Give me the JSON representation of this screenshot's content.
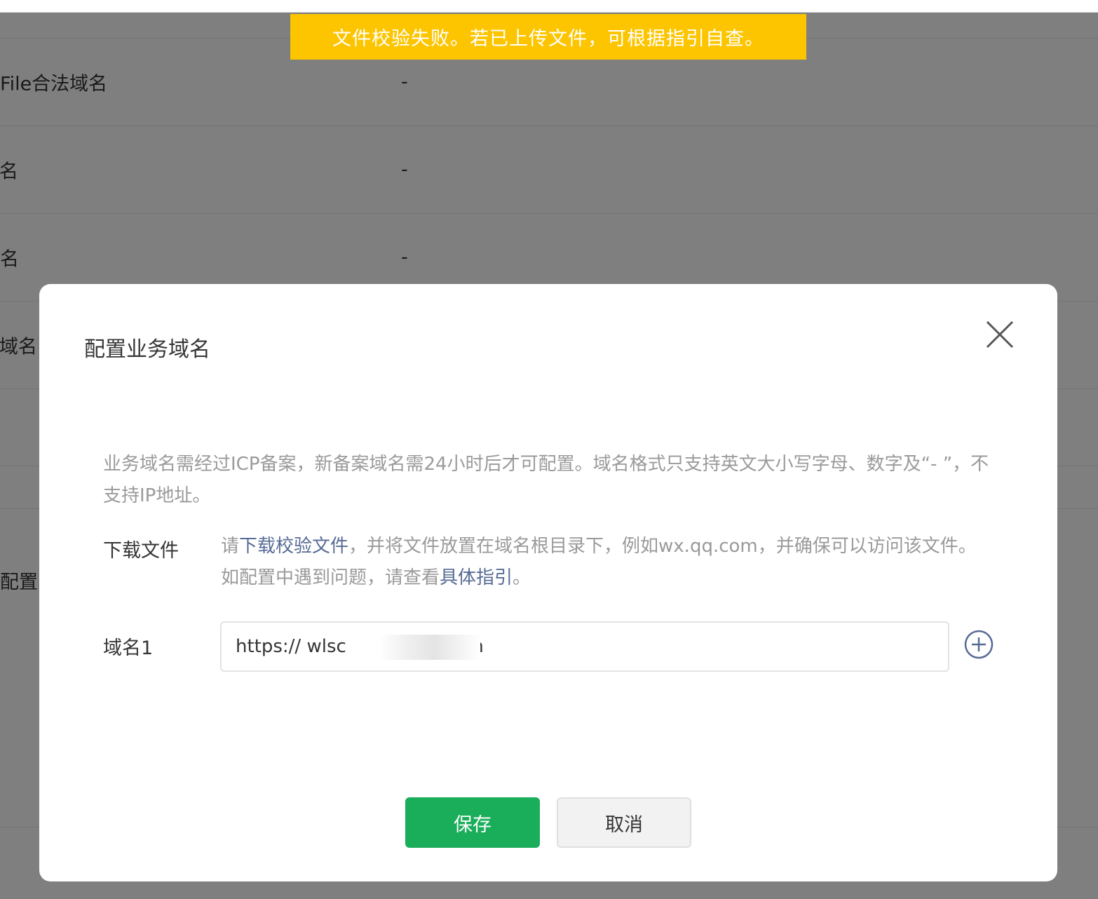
{
  "toast": {
    "message": "文件校验失败。若已上传文件，可根据指引自查。"
  },
  "background": {
    "rows": [
      {
        "label": "File合法域名",
        "value": "-"
      },
      {
        "label": "域名",
        "value": "-"
      },
      {
        "label": "名",
        "value": "-"
      },
      {
        "label": "新域名",
        "value": ""
      }
    ],
    "config_label": "配置"
  },
  "modal": {
    "title": "配置业务域名",
    "notice": "业务域名需经过ICP备案，新备案域名需24小时后才可配置。域名格式只支持英文大小写字母、数字及“- ”，不支持IP地址。",
    "download": {
      "label": "下载文件",
      "prefix": "请",
      "link": "下载校验文件",
      "middle": "，并将文件放置在域名根目录下，例如wx.qq.com，并确保可以访问该文件。如配置中遇到问题，请查看",
      "guide_link": "具体指引",
      "suffix": "。"
    },
    "domain": {
      "label": "域名1",
      "value": "https:// wlsc              n.com"
    },
    "buttons": {
      "save": "保存",
      "cancel": "取消"
    }
  },
  "colors": {
    "toast": "#fdc500",
    "primary_button": "#1aad5a",
    "link": "#576b95",
    "overlay": "rgba(0,0,0,0.5)"
  },
  "icons": {
    "close": "close-icon",
    "add": "plus-circle-icon"
  }
}
